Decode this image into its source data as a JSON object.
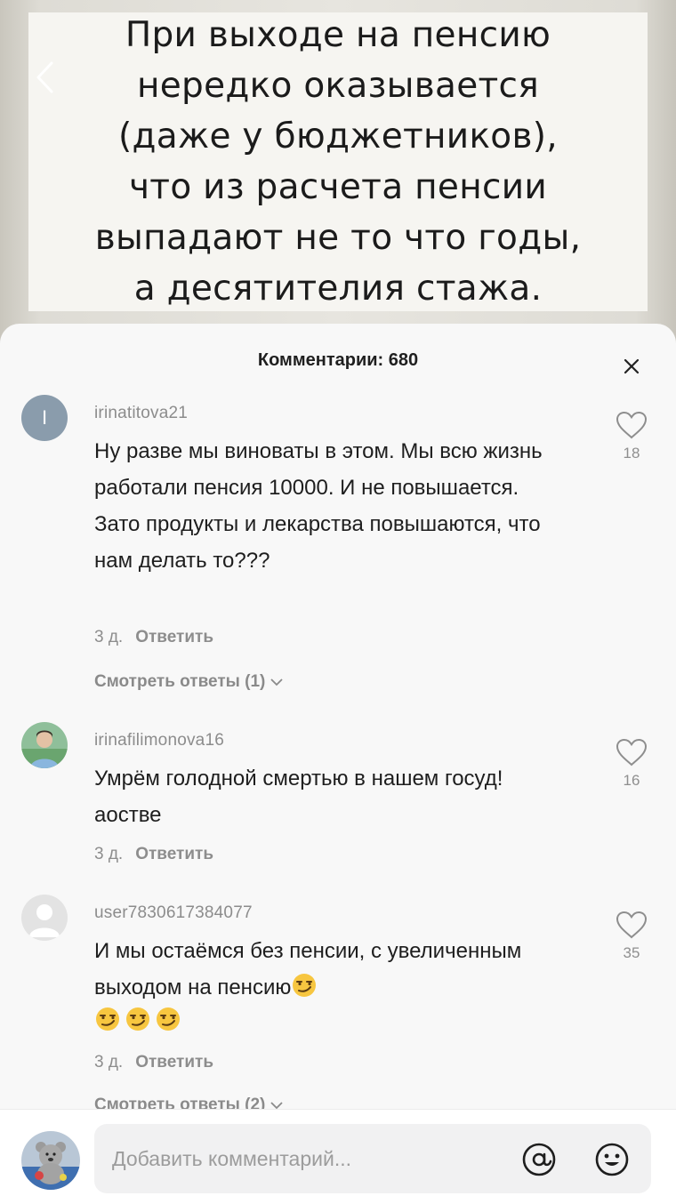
{
  "video": {
    "caption_lines": [
      "При выходе на пенсию",
      "нередко оказывается",
      "(даже у бюджетников),",
      "что из расчета пенсии",
      "выпадают не то что годы,",
      "а десятителия стажа."
    ]
  },
  "sheet": {
    "title": "Комментарии: 680"
  },
  "comments": [
    {
      "avatar_letter": "I",
      "username": "irinatitova21",
      "text": "Ну разве мы виноваты в этом. Мы всю жизнь работали пенсия 10000. И не повышается. Зато продукты и лекарства повышаются, что нам делать то???",
      "time": "3 д.",
      "reply_label": "Ответить",
      "likes": "18",
      "view_replies": "Смотреть ответы (1)"
    },
    {
      "username": "irinafilimonova16",
      "text": "Умрём голодной смертью в нашем госуд! аостве",
      "time": "3 д.",
      "reply_label": "Ответить",
      "likes": "16"
    },
    {
      "username": "user7830617384077",
      "text": "И мы остаёмся без пенсии, с увеличенным выходом на пенсию",
      "time": "3 д.",
      "reply_label": "Ответить",
      "likes": "35",
      "emoji": "smirking-face-emoji",
      "view_replies": "Смотреть ответы (2)"
    }
  ],
  "input": {
    "placeholder": "Добавить комментарий..."
  },
  "icons": {
    "back": "chevron-left-icon",
    "close": "close-icon",
    "like": "heart-outline-icon",
    "mention": "at-sign-icon",
    "emoji": "smiley-icon"
  },
  "colors": {
    "sheet_bg": "#f8f8f8",
    "username": "#8c8c8c",
    "text": "#1e1e1e",
    "caption_bg": "#f6f5f1"
  }
}
